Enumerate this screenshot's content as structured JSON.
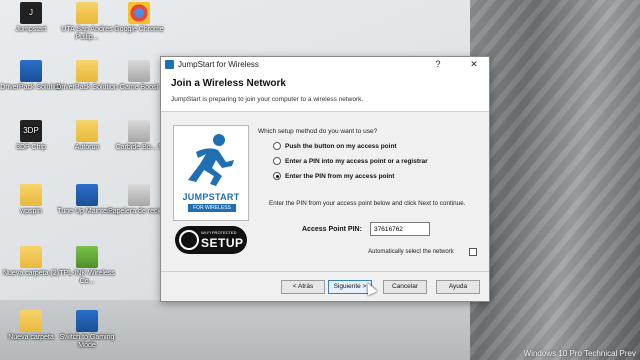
{
  "desktop": {
    "icons": [
      {
        "label": "Jumpstart"
      },
      {
        "label": "UTA San Andres Pullip..."
      },
      {
        "label": "Google Chrome"
      },
      {
        "label": "DriverPack Solution"
      },
      {
        "label": "DriverPack Solution"
      },
      {
        "label": "Game Boost"
      },
      {
        "label": "3DP Chip"
      },
      {
        "label": "Autorun"
      },
      {
        "label": "Carbide Bo... 5"
      },
      {
        "label": "wpspin"
      },
      {
        "label": "Tune Up Mainten..."
      },
      {
        "label": "Papelera de recicl..."
      },
      {
        "label": "Nueva carpeta (2)"
      },
      {
        "label": "TPL-INK Wireless Co..."
      },
      {
        "label": "Nueva carpeta"
      },
      {
        "label": "Switch to Gaming Mode"
      }
    ],
    "watermark": "Windows 10 Pro Technical Prev"
  },
  "dialog": {
    "title": "JumpStart for Wireless",
    "help_symbol": "?",
    "close_symbol": "✕",
    "heading": "Join a Wireless Network",
    "subheading": "JumpStart is preparing to join your computer to a wireless network.",
    "logo": {
      "line1": "JUMPSTART",
      "line2": "FOR WIRELESS"
    },
    "wps": {
      "line1": "WI-FI PROTECTED",
      "line2": "SETUP"
    },
    "question": "Which setup method do you want to use?",
    "options": [
      {
        "label": "Push the button on my access point",
        "checked": false
      },
      {
        "label": "Enter a PIN into my access point or a registrar",
        "checked": false
      },
      {
        "label": "Enter the PIN from my access point",
        "checked": true
      }
    ],
    "instructions": "Enter the PIN from your access point below and click Next to continue.",
    "pin_label": "Access Point PIN:",
    "pin_value": "37616762",
    "auto_select_label": "Automatically select the network",
    "auto_select_checked": false,
    "buttons": {
      "back": "< Atrás",
      "next": "Siguiente >",
      "cancel": "Cancelar",
      "help": "Ayuda"
    }
  },
  "colors": {
    "accent": "#1f6fb5",
    "dialog_bg": "#f0f0f0"
  }
}
